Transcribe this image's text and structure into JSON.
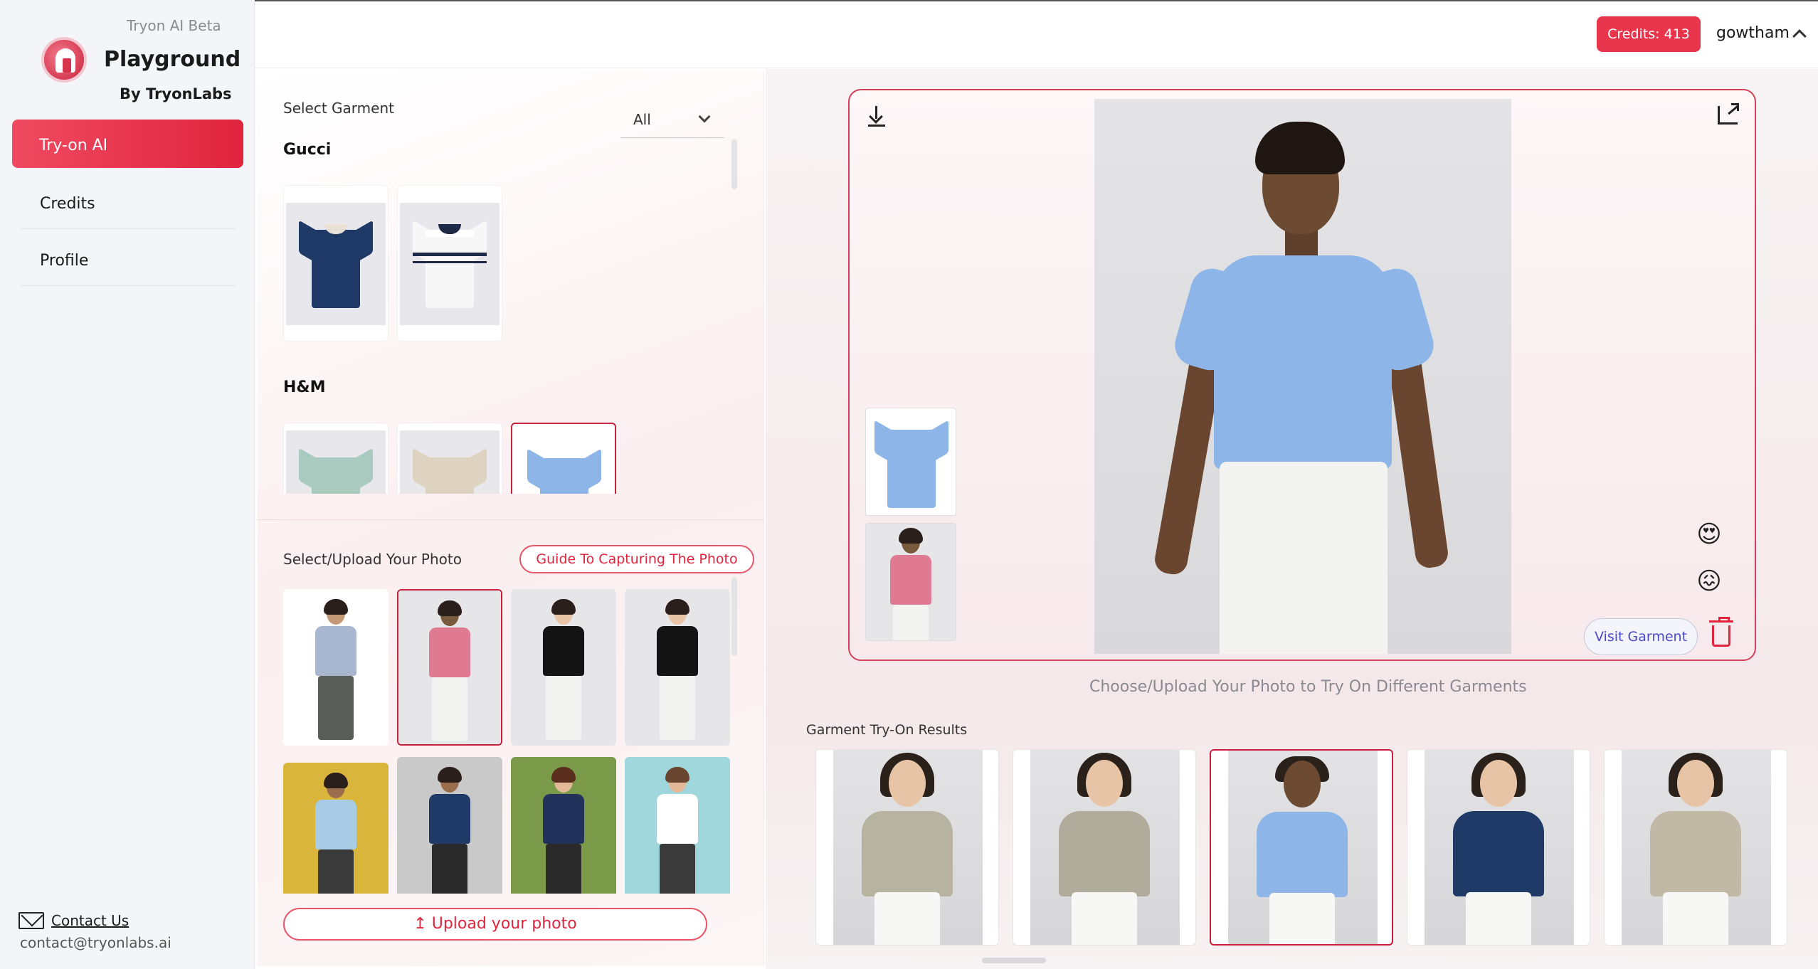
{
  "sidebar": {
    "beta_label": "Tryon AI Beta",
    "title": "Playground",
    "subtitle": "By TryonLabs",
    "nav": [
      {
        "label": "Try-on AI",
        "active": true
      },
      {
        "label": "Credits",
        "active": false
      },
      {
        "label": "Profile",
        "active": false
      }
    ],
    "contact_link": "Contact Us",
    "contact_email": "contact@tryonlabs.ai"
  },
  "header": {
    "credits_label": "Credits: 413",
    "username": "gowtham"
  },
  "garments": {
    "section_label": "Select Garment",
    "filter_value": "All",
    "brands": [
      {
        "name": "Gucci",
        "items": [
          {
            "color": "#1f3a66",
            "collar": "#e9e1d6",
            "selected": false
          },
          {
            "color": "#f7f7f7",
            "collar": "#1c2a48",
            "selected": false
          }
        ]
      },
      {
        "name": "H&M",
        "items": [
          {
            "color": "#a9cbbf",
            "collar": "#a9cbbf",
            "selected": false
          },
          {
            "color": "#ddd3c0",
            "collar": "#ddd3c0",
            "selected": false
          },
          {
            "color": "#8db5e8",
            "collar": "#8db5e8",
            "selected": true
          }
        ]
      }
    ]
  },
  "photos": {
    "section_label": "Select/Upload Your Photo",
    "guide_button": "Guide To Capturing The Photo",
    "upload_button": "Upload your photo",
    "items": [
      {
        "shirt": "#a9b6cf",
        "legs": "#5a5e58",
        "bg": "#ffffff",
        "selected": false
      },
      {
        "shirt": "#e07a92",
        "legs": "#f3f3f2",
        "bg": "#e6e6e8",
        "selected": true
      },
      {
        "shirt": "#141414",
        "legs": "#f3f3f2",
        "bg": "#e6e6e8",
        "selected": false
      },
      {
        "shirt": "#141414",
        "legs": "#f3f3f2",
        "bg": "#e6e6e8",
        "selected": false
      },
      {
        "shirt": "#a8cce6",
        "legs": "#3a3a3a",
        "bg": "#d9b53c",
        "selected": false
      },
      {
        "shirt": "#1f3a66",
        "legs": "#2a2a2a",
        "bg": "#c9c9c9",
        "selected": false
      },
      {
        "shirt": "#23325a",
        "legs": "#2a2a2a",
        "bg": "#7a9a4a",
        "selected": false
      },
      {
        "shirt": "#ffffff",
        "legs": "#3a3a3a",
        "bg": "#9fd7dc",
        "selected": false
      }
    ]
  },
  "result": {
    "emoji_love": "😍",
    "emoji_dislike": "😖",
    "visit_button": "Visit Garment",
    "hint": "Choose/Upload Your Photo to Try On Different Garments",
    "shirt_color": "#8db5e8"
  },
  "results": {
    "label": "Garment Try-On Results",
    "items": [
      {
        "shirt": "#b6b3a0",
        "selected": false
      },
      {
        "shirt": "#b1ab9c",
        "selected": false
      },
      {
        "shirt": "#8db5e8",
        "selected": true
      },
      {
        "shirt": "#1f3a66",
        "selected": false
      },
      {
        "shirt": "#c2b8a6",
        "selected": false
      }
    ]
  },
  "colors": {
    "accent": "#e0243d",
    "accent_light": "#ef4a61"
  }
}
